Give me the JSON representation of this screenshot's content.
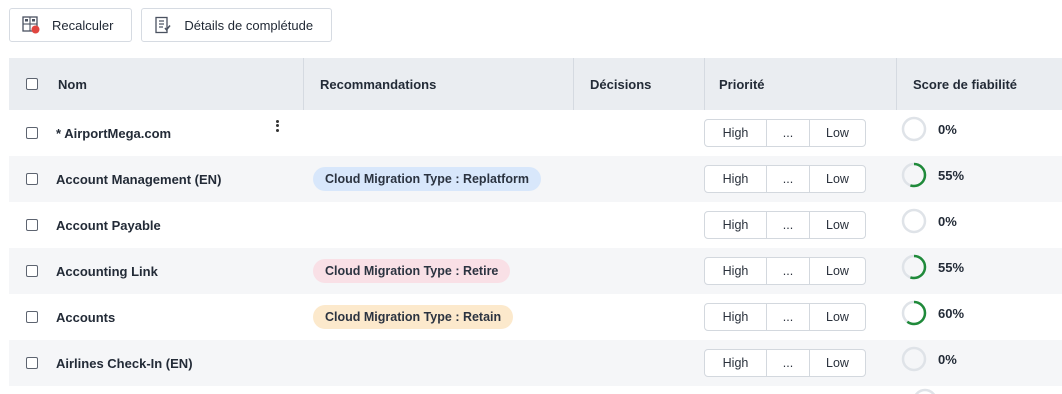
{
  "toolbar": {
    "recalculate_label": "Recalculer",
    "details_label": "Détails de complétude"
  },
  "columns": {
    "name": "Nom",
    "recommendations": "Recommandations",
    "decisions": "Décisions",
    "priority": "Priorité",
    "score": "Score de fiabilité"
  },
  "priority_options": {
    "high": "High",
    "mid": "...",
    "low": "Low"
  },
  "colors": {
    "score_ring_track": "#dfe3e8",
    "score_ring_fill": "#1f8a3a",
    "tag_blue": "#d8e7fb",
    "tag_pink": "#f9e0e6",
    "tag_orange": "#fce9cc"
  },
  "rows": [
    {
      "name": "* AirportMega.com",
      "recommendation": "",
      "tag_color": "",
      "score": "0%",
      "score_value": 0,
      "has_menu": true
    },
    {
      "name": "Account Management (EN)",
      "recommendation": "Cloud Migration Type : Replatform",
      "tag_color": "blue",
      "score": "55%",
      "score_value": 55,
      "has_menu": false
    },
    {
      "name": "Account Payable",
      "recommendation": "",
      "tag_color": "",
      "score": "0%",
      "score_value": 0,
      "has_menu": false
    },
    {
      "name": "Accounting Link",
      "recommendation": "Cloud Migration Type : Retire",
      "tag_color": "pink",
      "score": "55%",
      "score_value": 55,
      "has_menu": false
    },
    {
      "name": "Accounts",
      "recommendation": "Cloud Migration Type : Retain",
      "tag_color": "orange",
      "score": "60%",
      "score_value": 60,
      "has_menu": false
    },
    {
      "name": "Airlines Check-In (EN)",
      "recommendation": "",
      "tag_color": "",
      "score": "0%",
      "score_value": 0,
      "has_menu": false
    }
  ]
}
